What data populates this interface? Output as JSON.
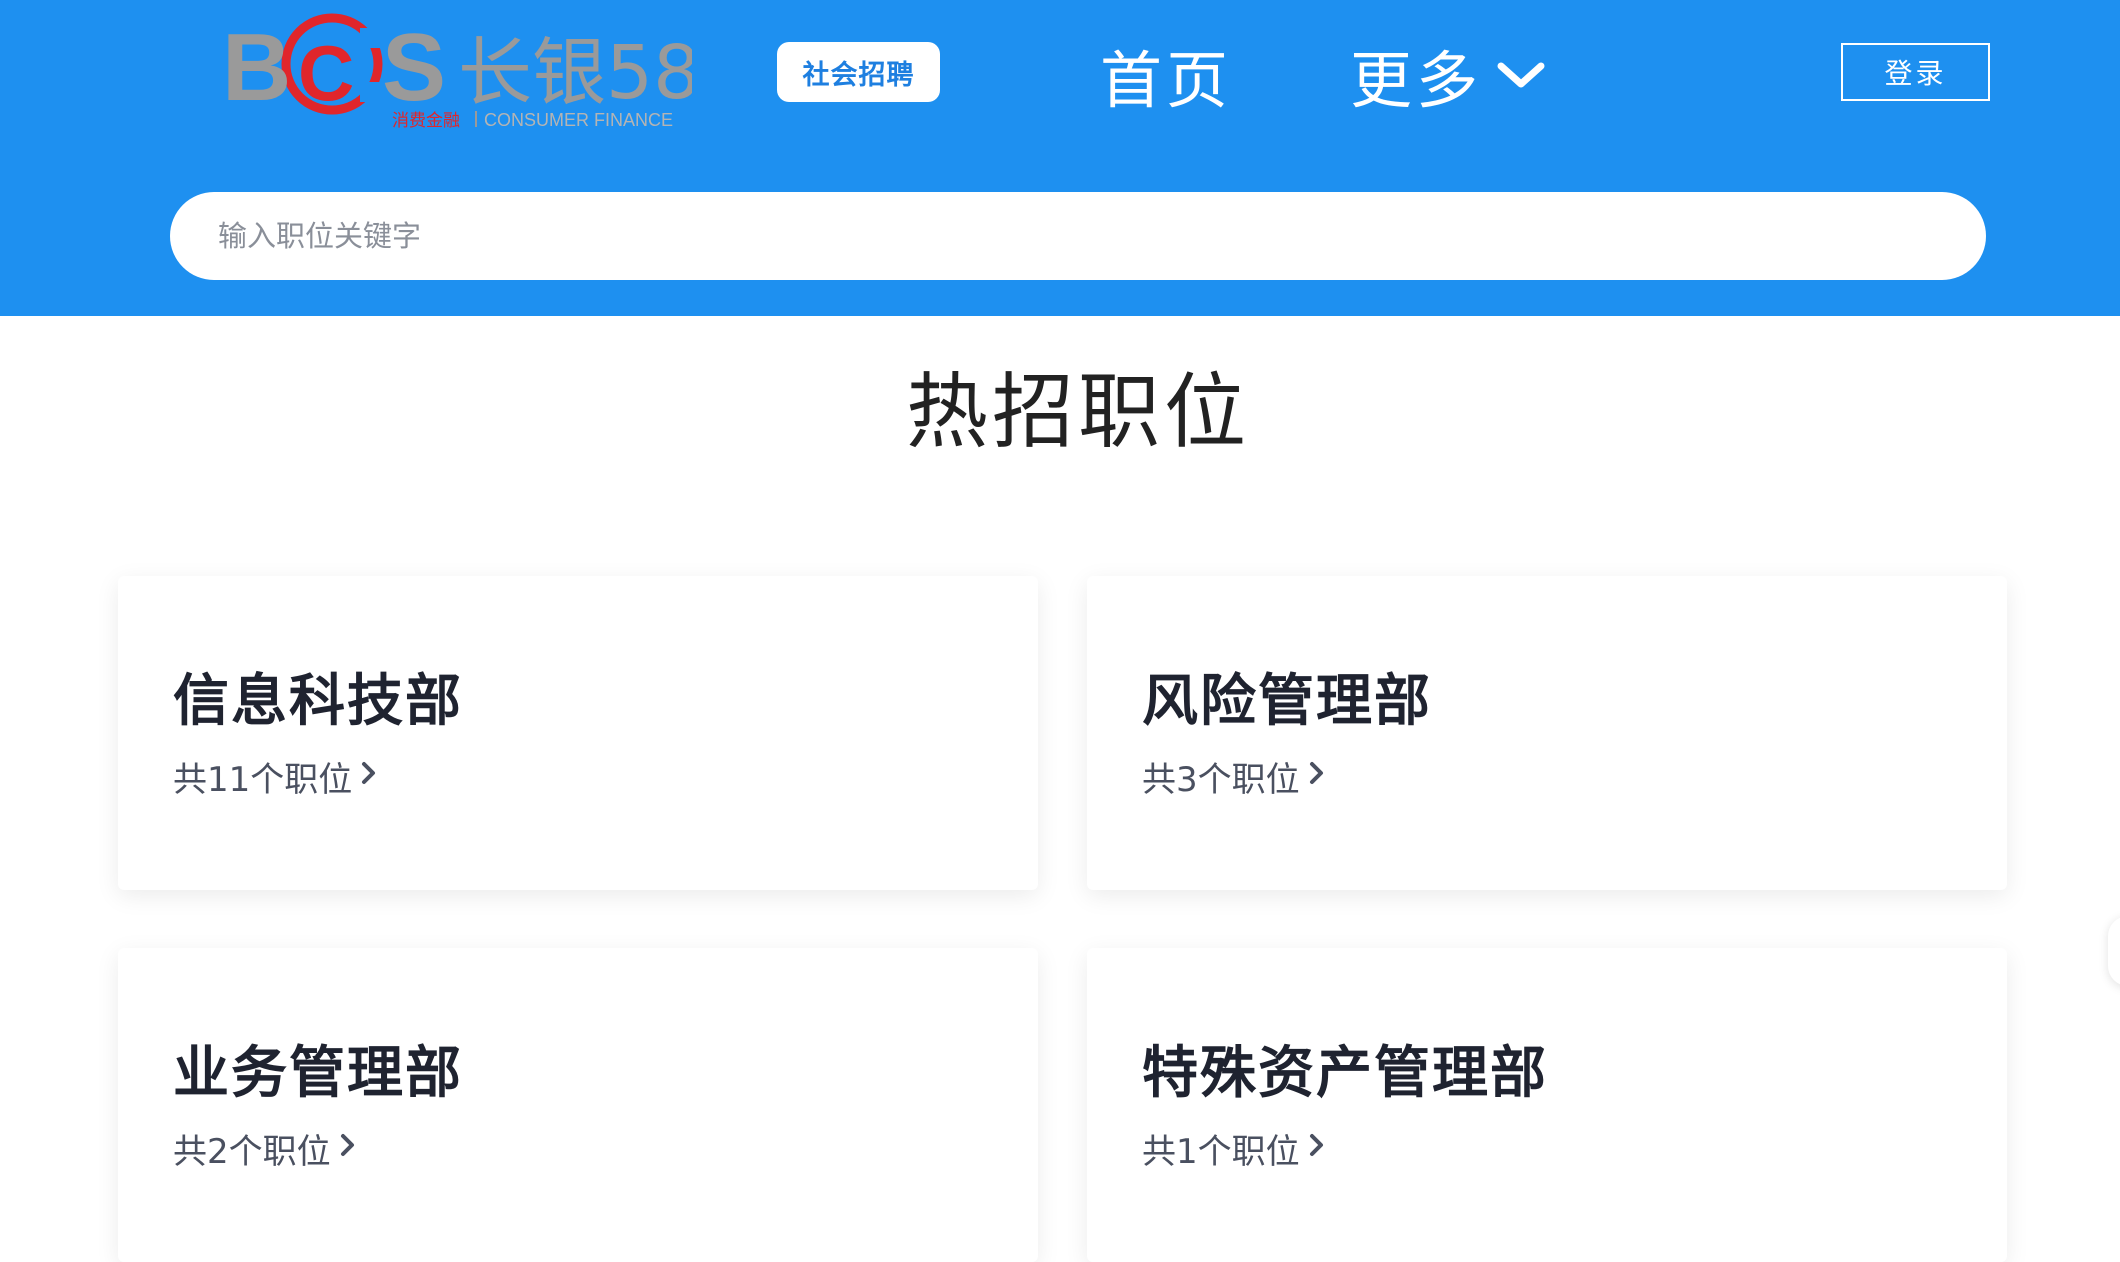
{
  "header": {
    "logo": {
      "brand_letters": "BCS",
      "brand_name": "长银58",
      "subtitle_cn": "消费金融",
      "subtitle_en": "CONSUMER FINANCE",
      "letter_color": "#9a9a9a",
      "accent_color": "#e0262b"
    },
    "tag_label": "社会招聘",
    "nav": {
      "home_label": "首页",
      "more_label": "更多"
    },
    "login_label": "登录",
    "background_color": "#1e90f0"
  },
  "search": {
    "placeholder": "输入职位关键字",
    "value": ""
  },
  "section": {
    "title": "热招职位"
  },
  "departments": [
    {
      "name": "信息科技部",
      "count_label": "共11个职位"
    },
    {
      "name": "风险管理部",
      "count_label": "共3个职位"
    },
    {
      "name": "业务管理部",
      "count_label": "共2个职位"
    },
    {
      "name": "特殊资产管理部",
      "count_label": "共1个职位"
    }
  ]
}
